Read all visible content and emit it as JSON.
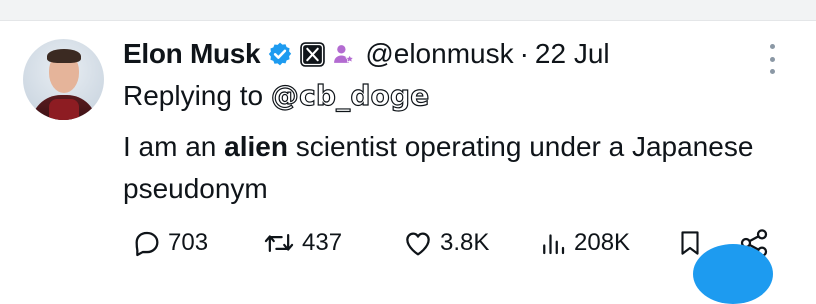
{
  "tweet": {
    "author_name": "Elon Musk",
    "handle": "@elonmusk",
    "separator": "·",
    "date": "22 Jul",
    "reply_prefix": "Replying to",
    "reply_mention": "@cb_doge",
    "text_before": "I am an ",
    "text_bold": "alien",
    "text_after": " scientist operating under a Japanese pseudonym",
    "badges": [
      "verified-check-icon",
      "x-affiliate-icon",
      "people-icon"
    ],
    "accent_color": "#1d9bf0",
    "badge_purple": "#b36bd1"
  },
  "actions": {
    "replies": "703",
    "reposts": "437",
    "likes": "3.8K",
    "views": "208K"
  }
}
